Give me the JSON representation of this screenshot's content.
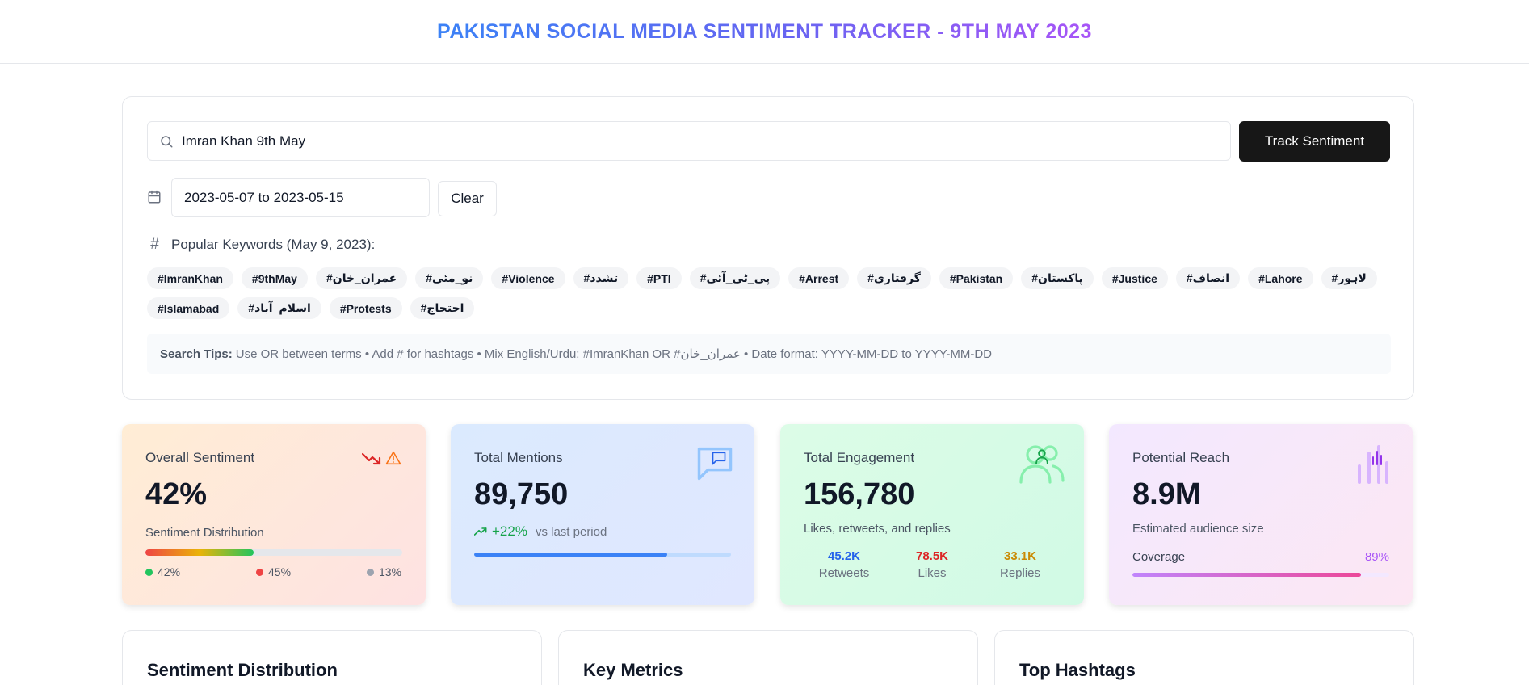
{
  "header": {
    "title": "PAKISTAN SOCIAL MEDIA SENTIMENT TRACKER - 9TH MAY 2023"
  },
  "search": {
    "value": "Imran Khan 9th May",
    "button": "Track Sentiment",
    "date_range": "2023-05-07 to 2023-05-15",
    "clear": "Clear"
  },
  "keywords": {
    "title": "Popular Keywords (May 9, 2023):",
    "items": [
      "#ImranKhan",
      "#9thMay",
      "#عمران_خان",
      "#نو_مئی",
      "#Violence",
      "#تشدد",
      "#PTI",
      "#پی_ٹی_آئی",
      "#Arrest",
      "#گرفتاری",
      "#Pakistan",
      "#پاکستان",
      "#Justice",
      "#انصاف",
      "#Lahore",
      "#لاہور",
      "#Islamabad",
      "#اسلام_آباد",
      "#Protests",
      "#احتجاج"
    ]
  },
  "tips": {
    "label": "Search Tips:",
    "text": "Use OR between terms • Add # for hashtags • Mix English/Urdu: #ImranKhan OR #عمران_خان • Date format: YYYY-MM-DD to YYYY-MM-DD"
  },
  "cards": {
    "sentiment": {
      "title": "Overall Sentiment",
      "value": "42%",
      "dist_label": "Sentiment Distribution",
      "bar_fraction": 0.42,
      "positive": "42%",
      "negative": "45%",
      "neutral": "13%",
      "colors": {
        "positive": "#22c55e",
        "negative": "#ef4444",
        "neutral": "#9ca3af"
      }
    },
    "mentions": {
      "title": "Total Mentions",
      "value": "89,750",
      "change": "+22%",
      "change_suffix": "vs last period",
      "bar_fraction": 0.75
    },
    "engagement": {
      "title": "Total Engagement",
      "value": "156,780",
      "subtitle": "Likes, retweets, and replies",
      "stats": [
        {
          "value": "45.2K",
          "label": "Retweets",
          "color": "#2563eb"
        },
        {
          "value": "78.5K",
          "label": "Likes",
          "color": "#dc2626"
        },
        {
          "value": "33.1K",
          "label": "Replies",
          "color": "#ca8a04"
        }
      ]
    },
    "reach": {
      "title": "Potential Reach",
      "value": "8.9M",
      "subtitle": "Estimated audience size",
      "coverage_label": "Coverage",
      "coverage_pct": "89%",
      "bar_fraction": 0.89
    }
  },
  "sections": [
    "Sentiment Distribution",
    "Key Metrics",
    "Top Hashtags"
  ],
  "icons": {
    "search": "search-icon",
    "calendar": "calendar-icon",
    "hash": "hash-icon",
    "trend_down": "trending-down-icon",
    "warning": "warning-icon",
    "message": "message-square-icon",
    "trend_up": "trending-up-icon",
    "users": "users-icon",
    "bars": "bar-chart-icon"
  }
}
